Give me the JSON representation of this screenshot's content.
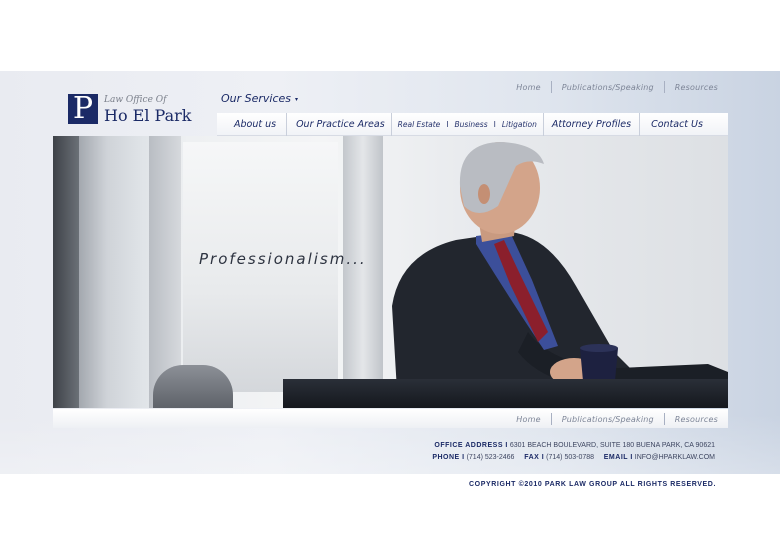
{
  "top_links": [
    "Home",
    "Publications/Speaking",
    "Resources"
  ],
  "logo": {
    "mark": "P",
    "small": "Law Office Of",
    "name": "Ho El Park"
  },
  "services": {
    "label": "Our Services",
    "caret": "▾"
  },
  "nav": {
    "about": "About us",
    "practice": "Our Practice Areas",
    "real_estate": "Real Estate",
    "business": "Business",
    "litigation": "Litigation",
    "pipe": "I",
    "attorney": "Attorney Profiles",
    "contact": "Contact Us"
  },
  "hero": {
    "tagline": "Professionalism..."
  },
  "bottom_links": [
    "Home",
    "Publications/Speaking",
    "Resources"
  ],
  "contact": {
    "address_label": "OFFICE ADDRESS I",
    "address": "6301 BEACH BOULEVARD, SUITE 180 BUENA PARK, CA  90621",
    "phone_label": "PHONE I",
    "phone": "(714) 523-2466",
    "fax_label": "FAX I",
    "fax": "(714) 503-0788",
    "email_label": "EMAIL I",
    "email": "INFO@HPARKLAW.COM"
  },
  "copyright": "COPYRIGHT ©2010 PARK LAW GROUP  ALL RIGHTS RESERVED.",
  "colors": {
    "brand_navy": "#1b2a66",
    "link_gray": "#7d8597"
  }
}
